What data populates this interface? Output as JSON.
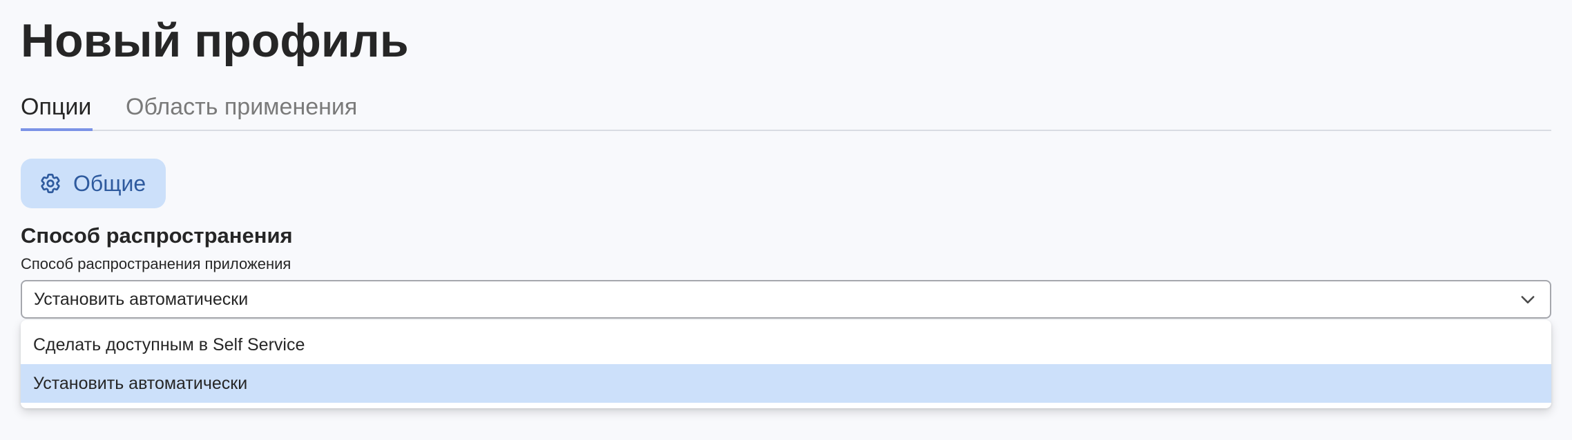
{
  "page": {
    "title": "Новый профиль"
  },
  "tabs": [
    {
      "label": "Опции",
      "active": true
    },
    {
      "label": "Область применения",
      "active": false
    }
  ],
  "general_button": {
    "label": "Общие",
    "icon": "gear-icon"
  },
  "section": {
    "title": "Способ распространения",
    "field_label": "Способ распространения приложения",
    "select": {
      "value": "Установить автоматически",
      "icon": "chevron-down-icon",
      "options": [
        {
          "label": "Сделать доступным в Self Service",
          "highlighted": false
        },
        {
          "label": "Установить автоматически",
          "highlighted": true
        }
      ]
    }
  },
  "colors": {
    "background": "#f8f9fc",
    "active_tab_underline": "#7b93e6",
    "general_button_bg": "#cce0fa",
    "general_button_text": "#2e5a9e",
    "highlighted_option_bg": "#cce0fa",
    "inactive_tab_text": "#7a7a7a"
  }
}
